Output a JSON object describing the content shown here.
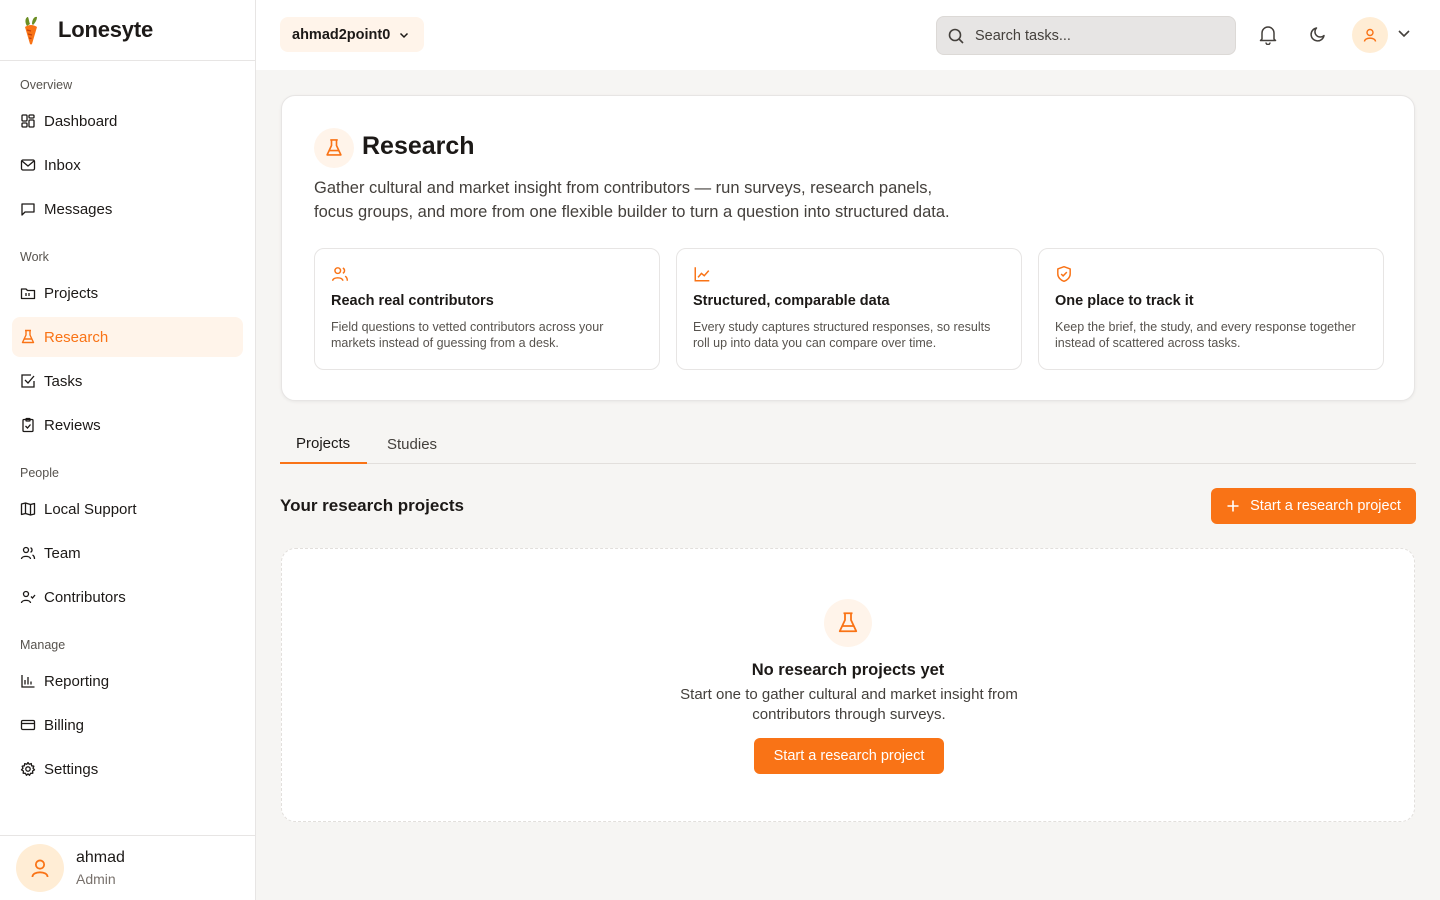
{
  "app": {
    "name": "Lonesyte"
  },
  "workspace": {
    "label": "ahmad2point0"
  },
  "search": {
    "placeholder": "Search tasks..."
  },
  "sidebar": {
    "sections": [
      {
        "heading": "Overview",
        "items": [
          {
            "label": "Dashboard",
            "icon": "dashboard-icon"
          },
          {
            "label": "Inbox",
            "icon": "mail-icon"
          },
          {
            "label": "Messages",
            "icon": "message-icon"
          }
        ]
      },
      {
        "heading": "Work",
        "items": [
          {
            "label": "Projects",
            "icon": "folder-icon"
          },
          {
            "label": "Research",
            "icon": "flask-icon",
            "active": true
          },
          {
            "label": "Tasks",
            "icon": "check-square-icon"
          },
          {
            "label": "Reviews",
            "icon": "clipboard-check-icon"
          }
        ]
      },
      {
        "heading": "People",
        "items": [
          {
            "label": "Local Support",
            "icon": "map-icon"
          },
          {
            "label": "Team",
            "icon": "users-icon"
          },
          {
            "label": "Contributors",
            "icon": "user-check-icon"
          }
        ]
      },
      {
        "heading": "Manage",
        "items": [
          {
            "label": "Reporting",
            "icon": "bar-chart-icon"
          },
          {
            "label": "Billing",
            "icon": "credit-card-icon"
          },
          {
            "label": "Settings",
            "icon": "gear-icon"
          }
        ]
      }
    ],
    "user": {
      "name": "ahmad",
      "role": "Admin"
    }
  },
  "hero": {
    "title": "Research",
    "description_line1": "Gather cultural and market insight from contributors — run surveys, research panels,",
    "description_line2": "focus groups, and more from one flexible builder to turn a question into structured data.",
    "features": [
      {
        "icon": "users-icon",
        "title": "Reach real contributors",
        "desc_line1": "Field questions to vetted contributors across your",
        "desc_line2": "markets instead of guessing from a desk."
      },
      {
        "icon": "line-chart-icon",
        "title": "Structured, comparable data",
        "desc_line1": "Every study captures structured responses, so results",
        "desc_line2": "roll up into data you can compare over time."
      },
      {
        "icon": "shield-check-icon",
        "title": "One place to track it",
        "desc_line1": "Keep the brief, the study, and every response together",
        "desc_line2": "instead of scattered across tasks."
      }
    ]
  },
  "tabs": {
    "projects": "Projects",
    "studies": "Studies",
    "active": "Projects"
  },
  "projects_section": {
    "title": "Your research projects",
    "start_button": "Start a research project"
  },
  "empty_state": {
    "title": "No research projects yet",
    "desc_line1": "Start one to gather cultural and market insight from",
    "desc_line2": "contributors through surveys.",
    "button": "Start a research project"
  },
  "colors": {
    "accent": "#f97316",
    "accent_soft": "#fff4ea",
    "background": "#f6f5f3",
    "text": "#1c1917"
  }
}
